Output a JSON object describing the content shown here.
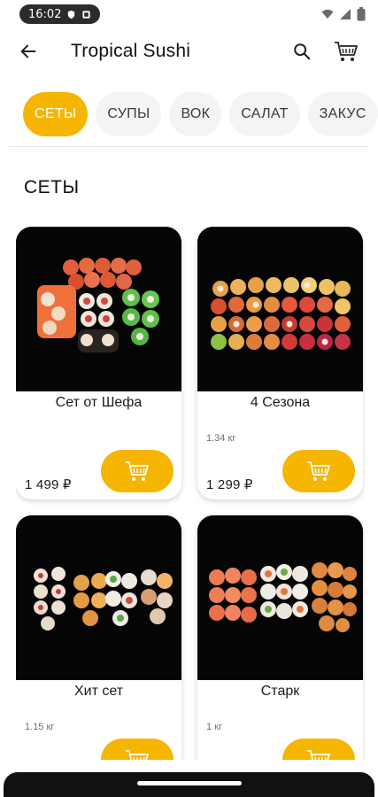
{
  "status_bar": {
    "time": "16:02"
  },
  "app_bar": {
    "title": "Tropical Sushi",
    "back_icon": "arrow-left-icon",
    "search_icon": "search-icon",
    "cart_icon": "cart-icon"
  },
  "categories": [
    {
      "label": "СЕТЫ",
      "active": true
    },
    {
      "label": "СУПЫ",
      "active": false
    },
    {
      "label": "ВОК",
      "active": false
    },
    {
      "label": "САЛАТ",
      "active": false
    },
    {
      "label": "ЗАКУС",
      "active": false
    }
  ],
  "section": {
    "title": "СЕТЫ"
  },
  "products": [
    {
      "name": "Сет от Шефа",
      "weight": "",
      "price": "1 499 ₽"
    },
    {
      "name": "4 Сезона",
      "weight": "1.34 кг",
      "price": "1 299 ₽"
    },
    {
      "name": "Хит сет",
      "weight": "1.15 кг",
      "price": ""
    },
    {
      "name": "Старк",
      "weight": "1 кг",
      "price": ""
    }
  ],
  "colors": {
    "accent": "#f5b500",
    "chip_bg": "#f4f4f4",
    "image_bg": "#050505"
  }
}
